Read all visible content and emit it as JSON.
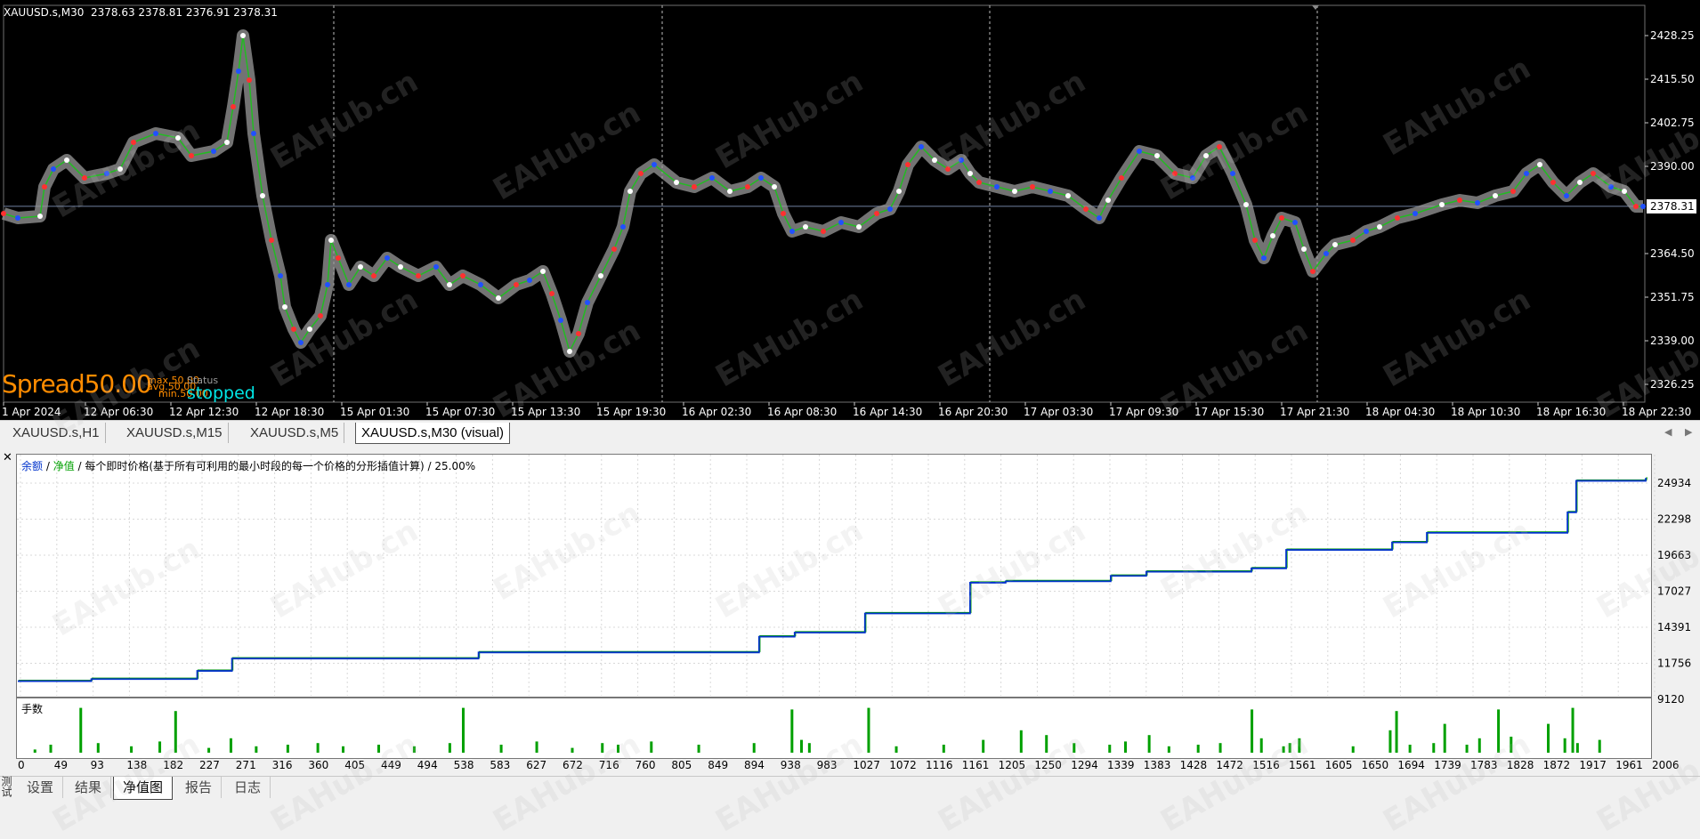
{
  "price_chart": {
    "symbol_header": "XAUUSD.s,M30  2378.63 2378.81 2376.91 2378.31",
    "current_price": "2378.31",
    "price_axis": [
      "2428.25",
      "2415.50",
      "2402.75",
      "2390.00",
      "2364.50",
      "2351.75",
      "2339.00",
      "2326.25"
    ],
    "time_axis": [
      "1 Apr 2024",
      "12 Apr 06:30",
      "12 Apr 12:30",
      "12 Apr 18:30",
      "15 Apr 01:30",
      "15 Apr 07:30",
      "15 Apr 13:30",
      "15 Apr 19:30",
      "16 Apr 02:30",
      "16 Apr 08:30",
      "16 Apr 14:30",
      "16 Apr 20:30",
      "17 Apr 03:30",
      "17 Apr 09:30",
      "17 Apr 15:30",
      "17 Apr 21:30",
      "18 Apr 04:30",
      "18 Apr 10:30",
      "18 Apr 16:30",
      "18 Apr 22:30"
    ],
    "spread_label": "Spread",
    "spread_value": "50.00",
    "spread_max": "max.50.00",
    "spread_avg": "avg.50.00",
    "spread_min": "min.50.00",
    "status_label": "Status",
    "status_value": "stopped",
    "colors": {
      "background": "#000000",
      "axis_text": "#ffffff",
      "spread": "#ff8c00",
      "status": "#00e5e5",
      "bid_line": "#7080a0"
    }
  },
  "chart_tabs": [
    {
      "label": "XAUUSD.s,H1",
      "active": false
    },
    {
      "label": "XAUUSD.s,M15",
      "active": false
    },
    {
      "label": "XAUUSD.s,M5",
      "active": false
    },
    {
      "label": "XAUUSD.s,M30 (visual)",
      "active": true
    }
  ],
  "tester": {
    "legend_balance": "余额",
    "legend_sep1": " / ",
    "legend_equity": "净值",
    "legend_rest": " / 每个即时价格(基于所有可利用的最小时段的每一个价格的分形插值计算) / 25.00%",
    "lots_label": "手数",
    "watermark": "EAHub.cn"
  },
  "chart_data": [
    {
      "type": "line",
      "series": [
        {
          "name": "余额",
          "color": "#0033cc"
        },
        {
          "name": "净值",
          "color": "#00a000"
        }
      ],
      "y_ticks": [
        "24934",
        "22298",
        "19663",
        "17027",
        "14391",
        "11756",
        "9120"
      ],
      "ylim": [
        9120,
        24934
      ],
      "x": [
        0,
        93,
        227,
        271,
        583,
        938,
        983,
        1072,
        1205,
        1250,
        1383,
        1428,
        1561,
        1605,
        1739,
        1783,
        1961,
        1972,
        2060
      ],
      "balance": [
        10450,
        10600,
        11200,
        12100,
        12550,
        13700,
        14000,
        15400,
        17650,
        17750,
        18150,
        18450,
        18700,
        20050,
        20600,
        21300,
        22800,
        25100,
        25250
      ]
    },
    {
      "type": "bar",
      "name": "手数",
      "x_ticks": [
        "0",
        "49",
        "93",
        "138",
        "182",
        "227",
        "271",
        "316",
        "360",
        "405",
        "449",
        "494",
        "538",
        "583",
        "627",
        "672",
        "716",
        "760",
        "805",
        "849",
        "894",
        "938",
        "983",
        "1027",
        "1072",
        "1116",
        "1161",
        "1205",
        "1250",
        "1294",
        "1339",
        "1383",
        "1428",
        "1472",
        "1516",
        "1561",
        "1605",
        "1650",
        "1694",
        "1739",
        "1783",
        "1828",
        "1872",
        "1917",
        "1961",
        "2006"
      ],
      "xlim": [
        0,
        2060
      ],
      "x": [
        20,
        40,
        78,
        100,
        142,
        178,
        198,
        240,
        268,
        300,
        340,
        378,
        410,
        455,
        500,
        545,
        562,
        610,
        655,
        700,
        738,
        758,
        800,
        860,
        930,
        978,
        990,
        1000,
        1075,
        1110,
        1170,
        1220,
        1268,
        1300,
        1335,
        1380,
        1400,
        1430,
        1455,
        1492,
        1520,
        1560,
        1572,
        1600,
        1608,
        1620,
        1688,
        1735,
        1743,
        1760,
        1790,
        1804,
        1832,
        1848,
        1872,
        1888,
        1935,
        1956,
        1966,
        1972,
        2000
      ],
      "values": [
        0.2,
        0.5,
        2.8,
        0.6,
        0.4,
        0.7,
        2.6,
        0.3,
        0.9,
        0.4,
        0.5,
        0.6,
        0.4,
        0.5,
        0.4,
        0.6,
        2.8,
        0.5,
        0.7,
        0.3,
        0.6,
        0.5,
        0.7,
        0.5,
        0.6,
        2.7,
        0.8,
        0.6,
        2.8,
        0.4,
        0.5,
        0.8,
        1.4,
        1.1,
        0.6,
        0.5,
        0.7,
        1.1,
        0.4,
        0.5,
        0.6,
        2.7,
        0.9,
        0.4,
        0.6,
        0.9,
        0.4,
        1.4,
        2.6,
        0.5,
        0.6,
        1.8,
        0.5,
        0.9,
        2.7,
        1.0,
        1.8,
        0.9,
        2.8,
        0.6,
        0.8
      ]
    }
  ],
  "bottom_tabs": [
    {
      "label": "设置",
      "active": false
    },
    {
      "label": "结果",
      "active": false
    },
    {
      "label": "净值图",
      "active": true
    },
    {
      "label": "报告",
      "active": false
    },
    {
      "label": "日志",
      "active": false
    }
  ],
  "side_label": "测试"
}
